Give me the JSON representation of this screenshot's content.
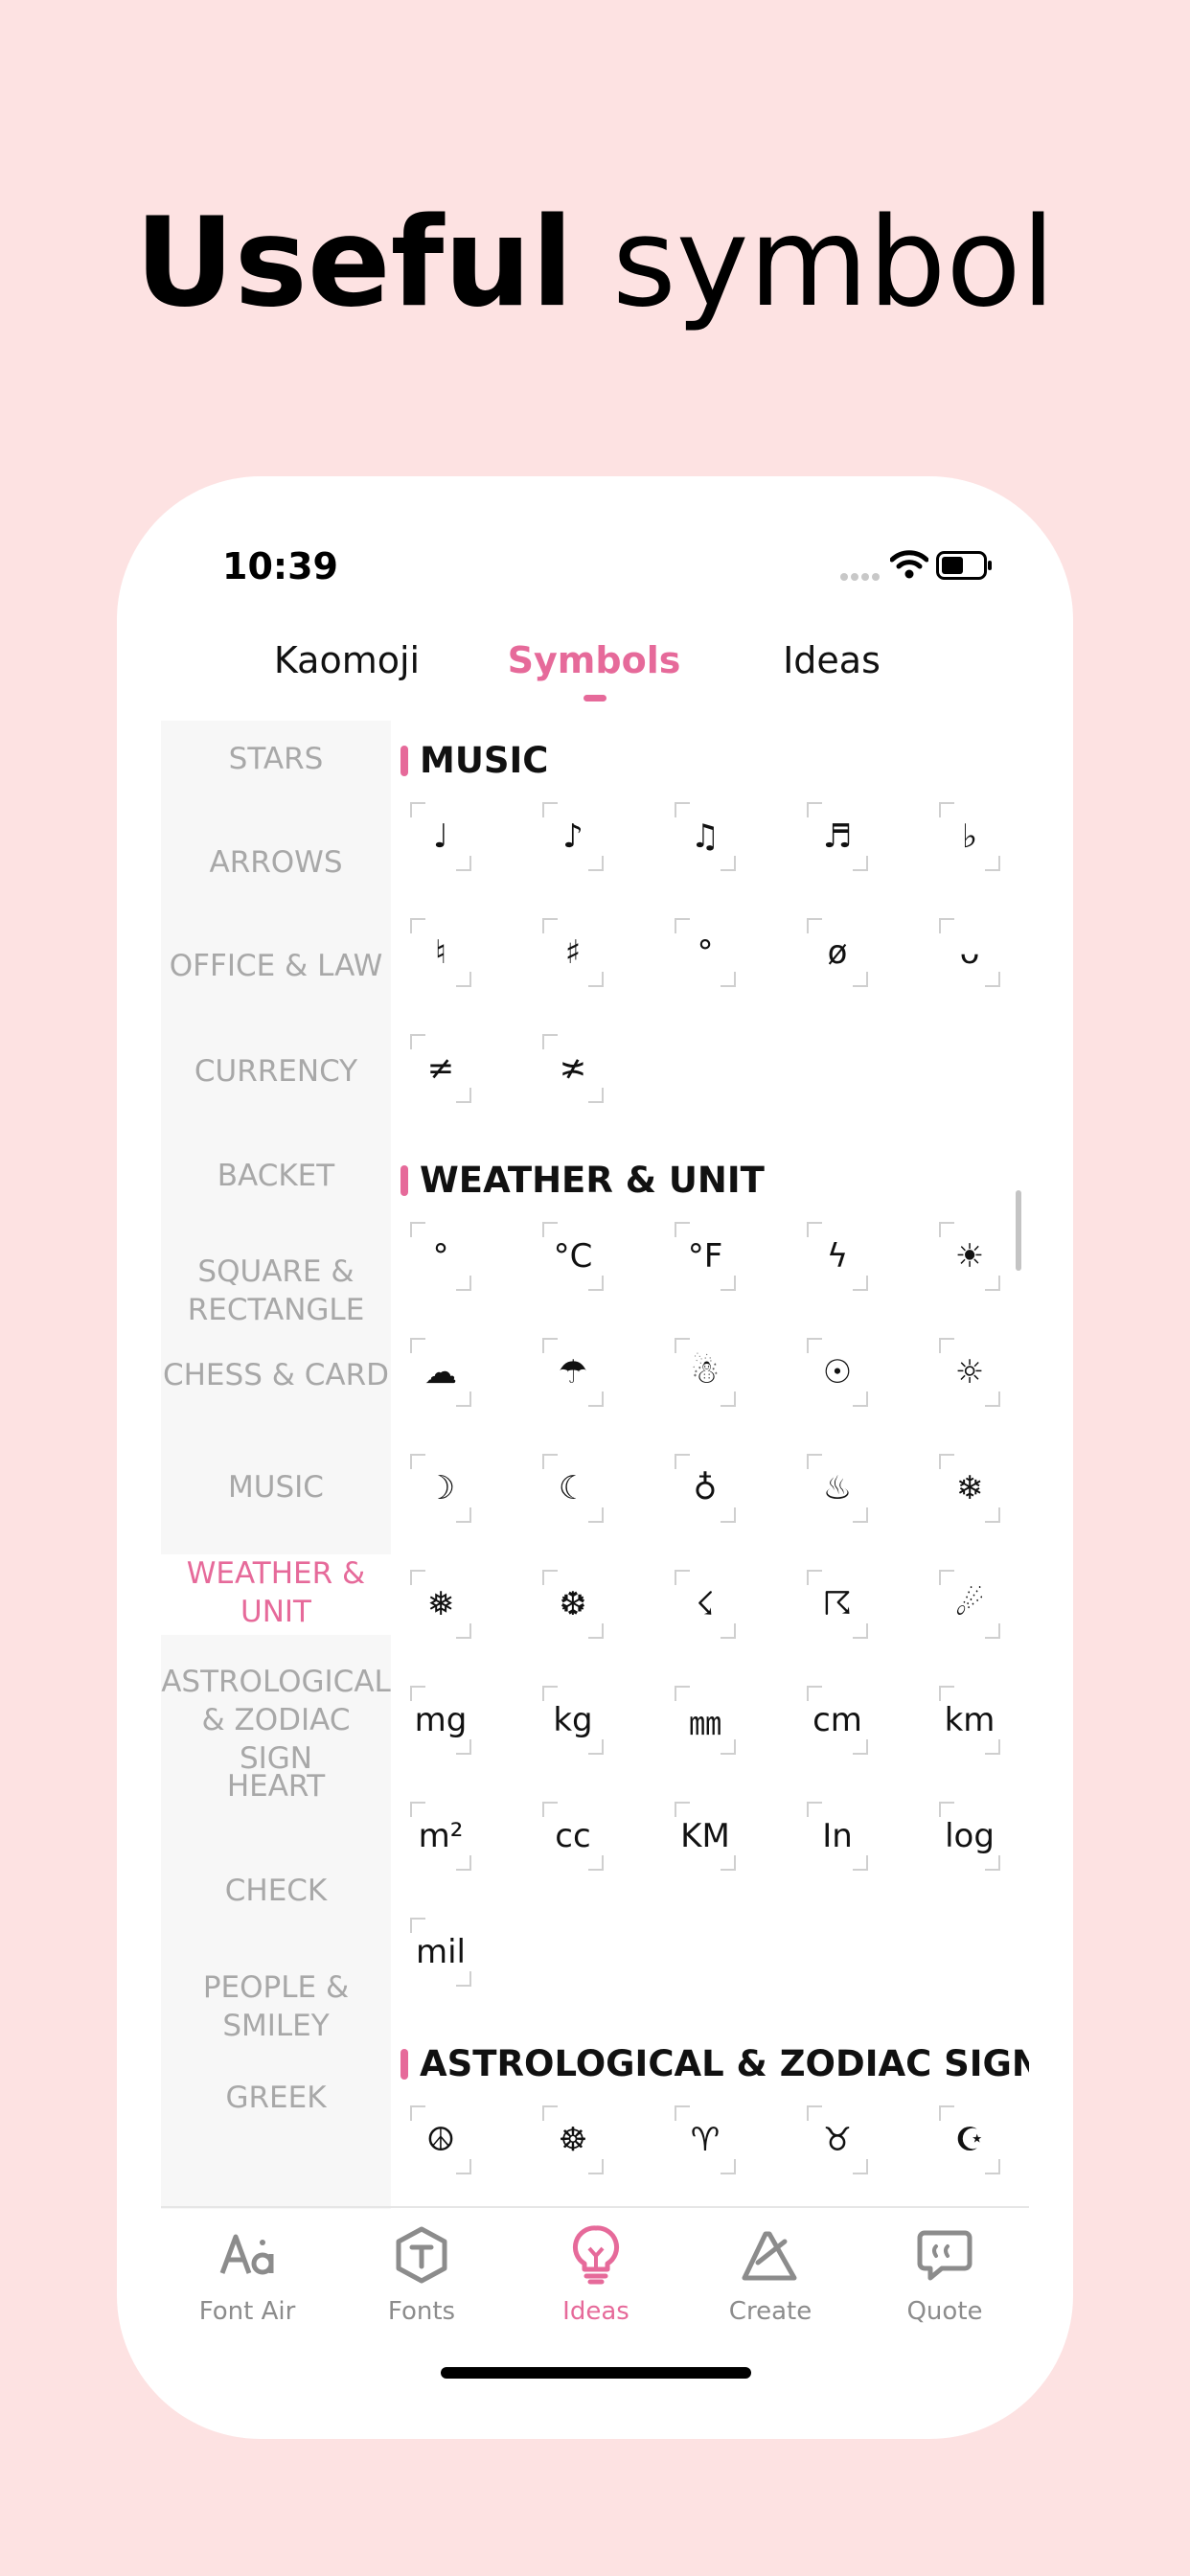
{
  "headline": {
    "bold": "Useful",
    "light": "symbol"
  },
  "status": {
    "time": "10:39"
  },
  "top_tabs": [
    {
      "label": "Kaomoji",
      "active": false
    },
    {
      "label": "Symbols",
      "active": true
    },
    {
      "label": "Ideas",
      "active": false
    }
  ],
  "categories": [
    {
      "label": "STARS",
      "active": false
    },
    {
      "label": "ARROWS",
      "active": false
    },
    {
      "label": "OFFICE & LAW",
      "active": false
    },
    {
      "label": "CURRENCY",
      "active": false
    },
    {
      "label": "BACKET",
      "active": false
    },
    {
      "label": "SQUARE & RECTANGLE",
      "active": false
    },
    {
      "label": "CHESS & CARD",
      "active": false
    },
    {
      "label": "MUSIC",
      "active": false
    },
    {
      "label": "WEATHER & UNIT",
      "active": true
    },
    {
      "label": "ASTROLOGICAL & ZODIAC SIGN",
      "active": false
    },
    {
      "label": "HEART",
      "active": false
    },
    {
      "label": "CHECK",
      "active": false
    },
    {
      "label": "PEOPLE & SMILEY",
      "active": false
    },
    {
      "label": "GREEK",
      "active": false
    }
  ],
  "sections": [
    {
      "title": "MUSIC",
      "symbols": [
        "♩",
        "♪",
        "♫",
        "♬",
        "♭",
        "♮",
        "♯",
        "°",
        "ø",
        "ᴗ",
        "≠",
        "≭"
      ]
    },
    {
      "title": "WEATHER & UNIT",
      "symbols": [
        "°",
        "°C",
        "°F",
        "ϟ",
        "☀",
        "☁",
        "☂",
        "☃",
        "☉",
        "☼",
        "☽",
        "☾",
        "♁",
        "♨",
        "❄",
        "❅",
        "❆",
        "☇",
        "☈",
        "☄",
        "mg",
        "kg",
        "㎜",
        "cm",
        "km",
        "m²",
        "cc",
        "KM",
        "In",
        "log",
        "mil"
      ]
    },
    {
      "title": "ASTROLOGICAL & ZODIAC SIGN",
      "symbols": [
        "☮",
        "☸",
        "♈",
        "♉",
        "☪"
      ]
    }
  ],
  "tab_bar": [
    {
      "label": "Font Air",
      "icon": "font-air-icon",
      "active": false
    },
    {
      "label": "Fonts",
      "icon": "fonts-icon",
      "active": false
    },
    {
      "label": "Ideas",
      "icon": "lightbulb-icon",
      "active": true
    },
    {
      "label": "Create",
      "icon": "create-icon",
      "active": false
    },
    {
      "label": "Quote",
      "icon": "quote-icon",
      "active": false
    }
  ],
  "colors": {
    "background": "#fde2e2",
    "accent": "#e66a9a",
    "inactive_text": "#a8a8a8",
    "tab_inactive": "#8c8c8c"
  }
}
